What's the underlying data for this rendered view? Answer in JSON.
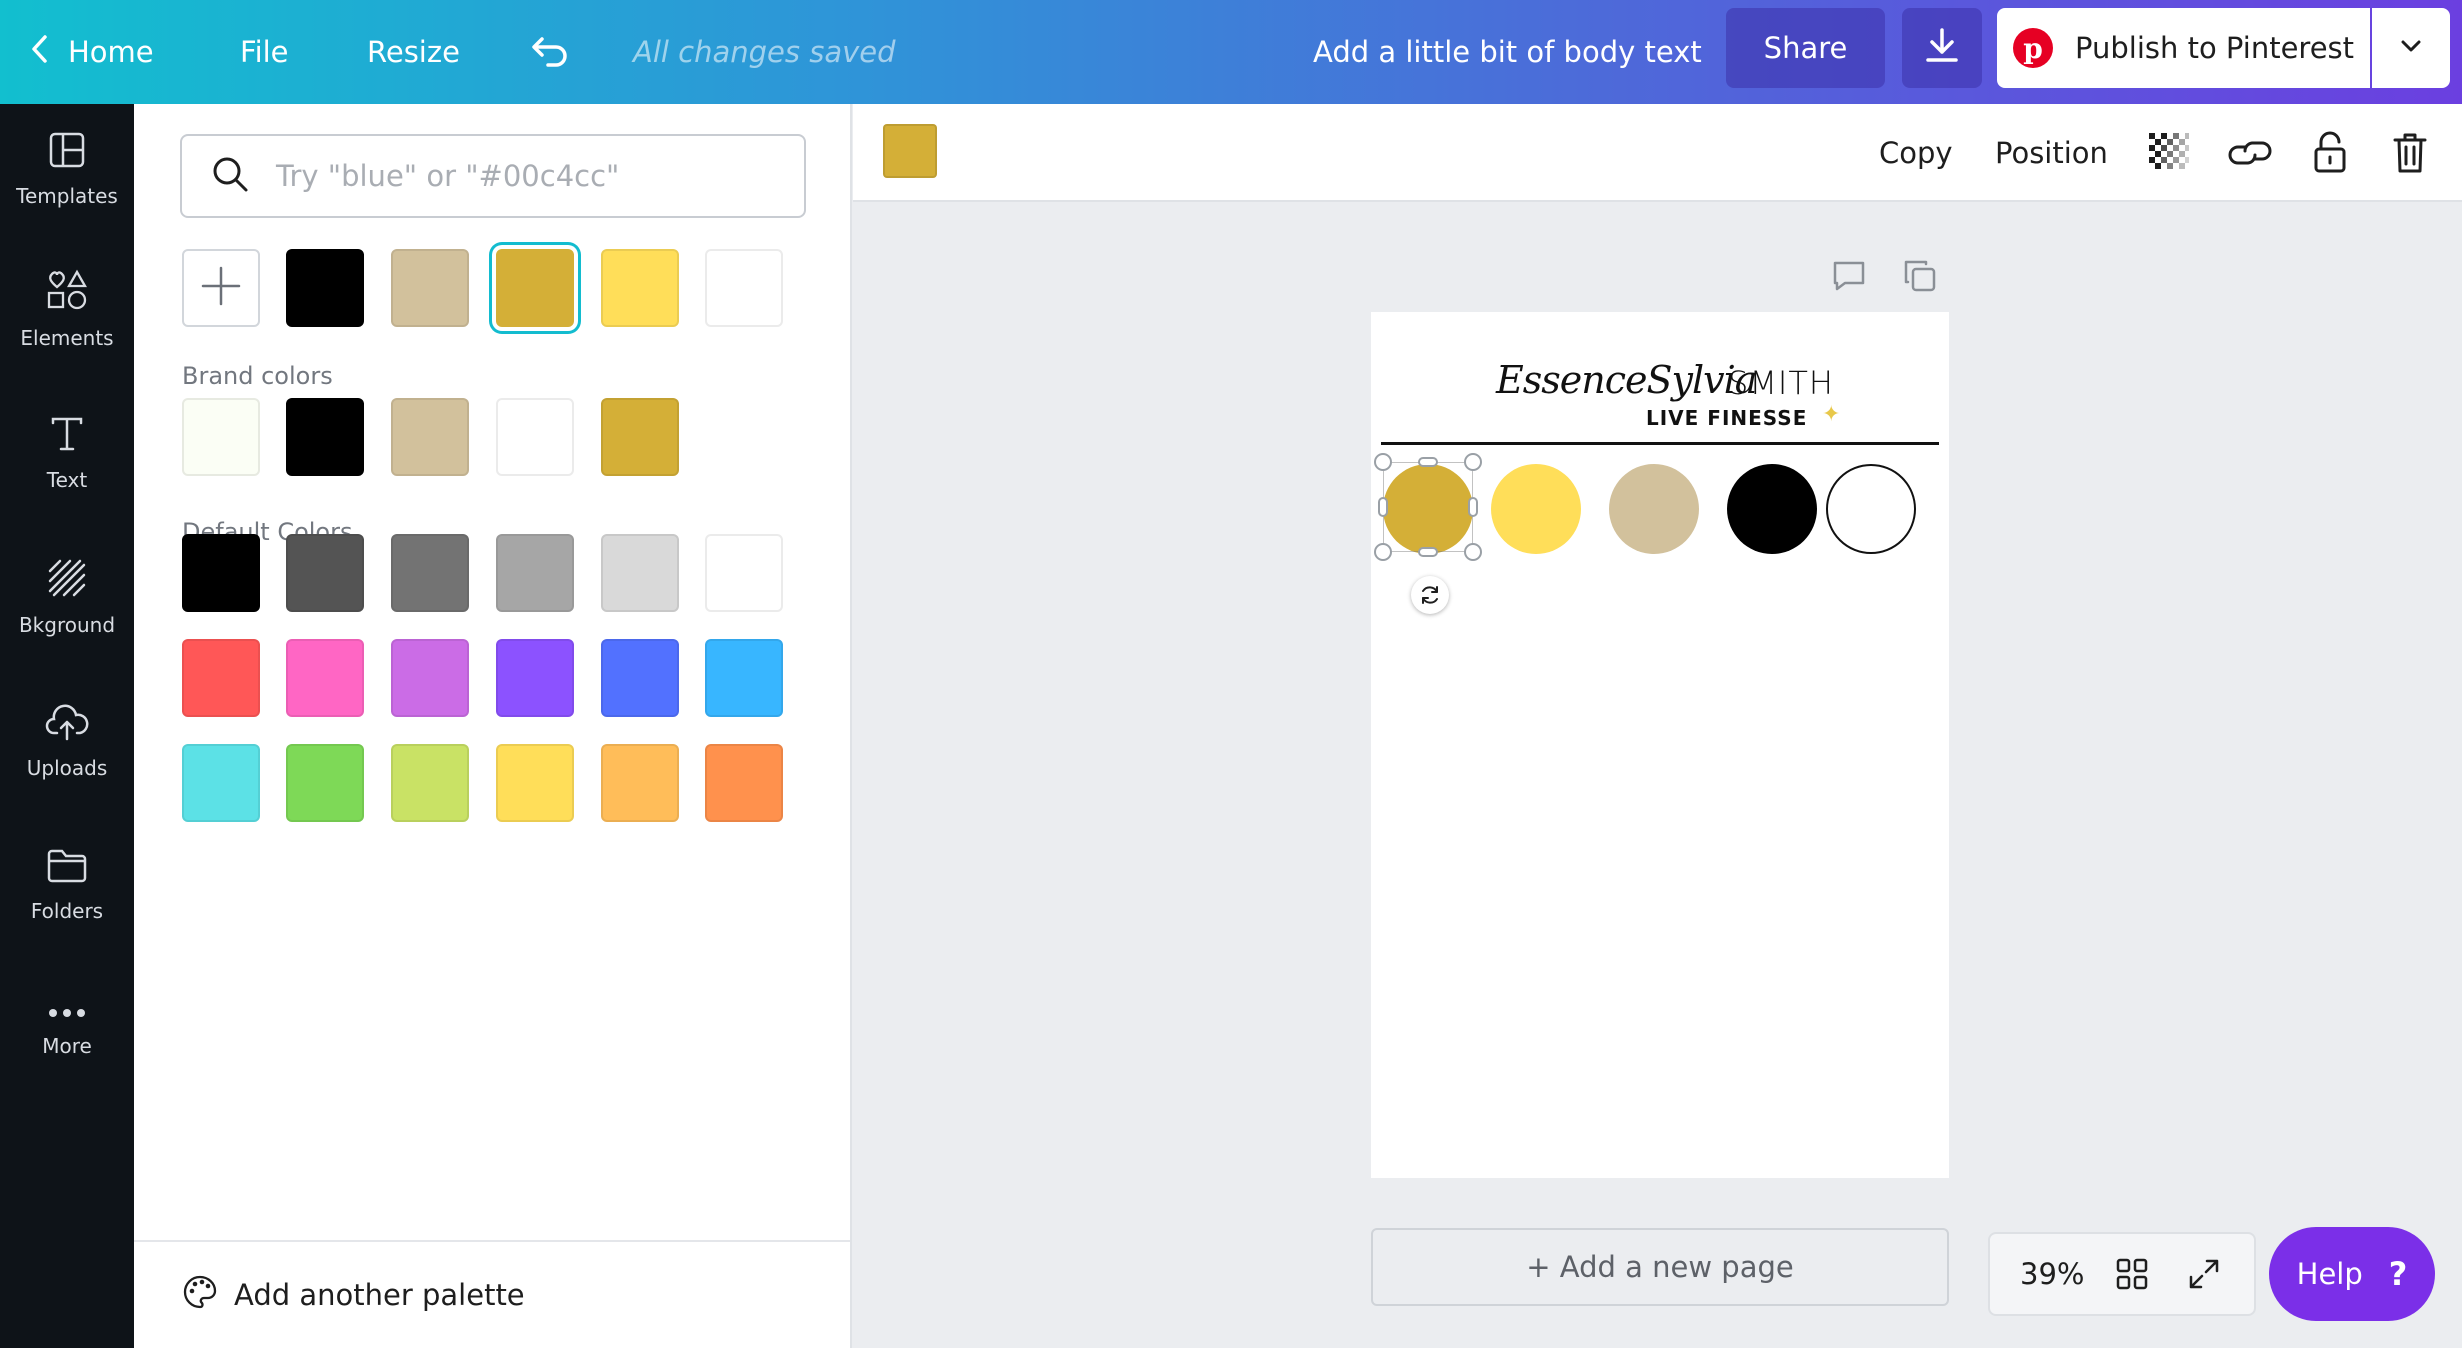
{
  "topbar": {
    "home": "Home",
    "file": "File",
    "resize": "Resize",
    "saved_status": "All changes saved",
    "doc_title": "Add a little bit of body text",
    "share": "Share",
    "publish": "Publish to Pinterest"
  },
  "sidebar": {
    "items": [
      {
        "label": "Templates",
        "icon": "templates-icon"
      },
      {
        "label": "Elements",
        "icon": "elements-icon"
      },
      {
        "label": "Text",
        "icon": "text-icon"
      },
      {
        "label": "Bkground",
        "icon": "background-icon"
      },
      {
        "label": "Uploads",
        "icon": "upload-cloud-icon"
      },
      {
        "label": "Folders",
        "icon": "folder-icon"
      },
      {
        "label": "More",
        "icon": "more-icon"
      }
    ]
  },
  "color_panel": {
    "search_placeholder": "Try \"blue\" or \"#00c4cc\"",
    "document_colors": [
      "#000000",
      "#d2c19c",
      "#d4af37",
      "#ffde59",
      "#ffffff"
    ],
    "selected_color": "#d4af37",
    "brand_label": "Brand colors",
    "brand_colors": [
      "#fbfef5",
      "#000000",
      "#d2c19c",
      "#ffffff",
      "#d4af37"
    ],
    "default_label": "Default Colors",
    "default_colors": [
      "#000000",
      "#545454",
      "#737373",
      "#a6a6a6",
      "#d9d9d9",
      "#ffffff",
      "#ff5757",
      "#ff66c4",
      "#cb6ce6",
      "#8c52ff",
      "#5271ff",
      "#38b6ff",
      "#5ce1e6",
      "#7ed957",
      "#c9e265",
      "#ffde59",
      "#ffbd59",
      "#ff914d"
    ],
    "footer": "Add another palette"
  },
  "toolbar": {
    "current_color": "#d4af37",
    "copy": "Copy",
    "position": "Position"
  },
  "design": {
    "logo_script": "EssenceSylvia",
    "logo_name": "SMITH",
    "logo_tagline": "LIVE FINESSE",
    "circles": [
      "#d4af37",
      "#ffde59",
      "#d2c19c",
      "#000000",
      "#ffffff"
    ]
  },
  "bottom": {
    "add_page": "+ Add a new page",
    "zoom": "39%",
    "help": "Help",
    "help_q": "?"
  },
  "theme": {
    "accent": "#13bccf",
    "help_purple": "#7b2fe8",
    "pinterest_red": "#e60023"
  }
}
